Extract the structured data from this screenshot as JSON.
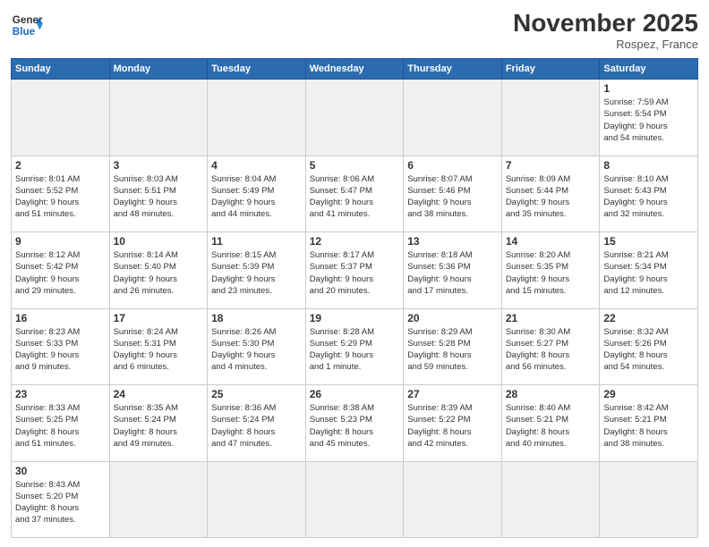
{
  "header": {
    "logo_general": "General",
    "logo_blue": "Blue",
    "month_title": "November 2025",
    "location": "Rospez, France"
  },
  "days_of_week": [
    "Sunday",
    "Monday",
    "Tuesday",
    "Wednesday",
    "Thursday",
    "Friday",
    "Saturday"
  ],
  "weeks": [
    [
      {
        "day": "",
        "empty": true
      },
      {
        "day": "",
        "empty": true
      },
      {
        "day": "",
        "empty": true
      },
      {
        "day": "",
        "empty": true
      },
      {
        "day": "",
        "empty": true
      },
      {
        "day": "",
        "empty": true
      },
      {
        "day": "1",
        "info": "Sunrise: 7:59 AM\nSunset: 5:54 PM\nDaylight: 9 hours\nand 54 minutes."
      }
    ],
    [
      {
        "day": "2",
        "info": "Sunrise: 8:01 AM\nSunset: 5:52 PM\nDaylight: 9 hours\nand 51 minutes."
      },
      {
        "day": "3",
        "info": "Sunrise: 8:03 AM\nSunset: 5:51 PM\nDaylight: 9 hours\nand 48 minutes."
      },
      {
        "day": "4",
        "info": "Sunrise: 8:04 AM\nSunset: 5:49 PM\nDaylight: 9 hours\nand 44 minutes."
      },
      {
        "day": "5",
        "info": "Sunrise: 8:06 AM\nSunset: 5:47 PM\nDaylight: 9 hours\nand 41 minutes."
      },
      {
        "day": "6",
        "info": "Sunrise: 8:07 AM\nSunset: 5:46 PM\nDaylight: 9 hours\nand 38 minutes."
      },
      {
        "day": "7",
        "info": "Sunrise: 8:09 AM\nSunset: 5:44 PM\nDaylight: 9 hours\nand 35 minutes."
      },
      {
        "day": "8",
        "info": "Sunrise: 8:10 AM\nSunset: 5:43 PM\nDaylight: 9 hours\nand 32 minutes."
      }
    ],
    [
      {
        "day": "9",
        "info": "Sunrise: 8:12 AM\nSunset: 5:42 PM\nDaylight: 9 hours\nand 29 minutes."
      },
      {
        "day": "10",
        "info": "Sunrise: 8:14 AM\nSunset: 5:40 PM\nDaylight: 9 hours\nand 26 minutes."
      },
      {
        "day": "11",
        "info": "Sunrise: 8:15 AM\nSunset: 5:39 PM\nDaylight: 9 hours\nand 23 minutes."
      },
      {
        "day": "12",
        "info": "Sunrise: 8:17 AM\nSunset: 5:37 PM\nDaylight: 9 hours\nand 20 minutes."
      },
      {
        "day": "13",
        "info": "Sunrise: 8:18 AM\nSunset: 5:36 PM\nDaylight: 9 hours\nand 17 minutes."
      },
      {
        "day": "14",
        "info": "Sunrise: 8:20 AM\nSunset: 5:35 PM\nDaylight: 9 hours\nand 15 minutes."
      },
      {
        "day": "15",
        "info": "Sunrise: 8:21 AM\nSunset: 5:34 PM\nDaylight: 9 hours\nand 12 minutes."
      }
    ],
    [
      {
        "day": "16",
        "info": "Sunrise: 8:23 AM\nSunset: 5:33 PM\nDaylight: 9 hours\nand 9 minutes."
      },
      {
        "day": "17",
        "info": "Sunrise: 8:24 AM\nSunset: 5:31 PM\nDaylight: 9 hours\nand 6 minutes."
      },
      {
        "day": "18",
        "info": "Sunrise: 8:26 AM\nSunset: 5:30 PM\nDaylight: 9 hours\nand 4 minutes."
      },
      {
        "day": "19",
        "info": "Sunrise: 8:28 AM\nSunset: 5:29 PM\nDaylight: 9 hours\nand 1 minute."
      },
      {
        "day": "20",
        "info": "Sunrise: 8:29 AM\nSunset: 5:28 PM\nDaylight: 8 hours\nand 59 minutes."
      },
      {
        "day": "21",
        "info": "Sunrise: 8:30 AM\nSunset: 5:27 PM\nDaylight: 8 hours\nand 56 minutes."
      },
      {
        "day": "22",
        "info": "Sunrise: 8:32 AM\nSunset: 5:26 PM\nDaylight: 8 hours\nand 54 minutes."
      }
    ],
    [
      {
        "day": "23",
        "info": "Sunrise: 8:33 AM\nSunset: 5:25 PM\nDaylight: 8 hours\nand 51 minutes."
      },
      {
        "day": "24",
        "info": "Sunrise: 8:35 AM\nSunset: 5:24 PM\nDaylight: 8 hours\nand 49 minutes."
      },
      {
        "day": "25",
        "info": "Sunrise: 8:36 AM\nSunset: 5:24 PM\nDaylight: 8 hours\nand 47 minutes."
      },
      {
        "day": "26",
        "info": "Sunrise: 8:38 AM\nSunset: 5:23 PM\nDaylight: 8 hours\nand 45 minutes."
      },
      {
        "day": "27",
        "info": "Sunrise: 8:39 AM\nSunset: 5:22 PM\nDaylight: 8 hours\nand 42 minutes."
      },
      {
        "day": "28",
        "info": "Sunrise: 8:40 AM\nSunset: 5:21 PM\nDaylight: 8 hours\nand 40 minutes."
      },
      {
        "day": "29",
        "info": "Sunrise: 8:42 AM\nSunset: 5:21 PM\nDaylight: 8 hours\nand 38 minutes."
      }
    ],
    [
      {
        "day": "30",
        "info": "Sunrise: 8:43 AM\nSunset: 5:20 PM\nDaylight: 8 hours\nand 37 minutes."
      },
      {
        "day": "",
        "empty": true
      },
      {
        "day": "",
        "empty": true
      },
      {
        "day": "",
        "empty": true
      },
      {
        "day": "",
        "empty": true
      },
      {
        "day": "",
        "empty": true
      },
      {
        "day": "",
        "empty": true
      }
    ]
  ]
}
